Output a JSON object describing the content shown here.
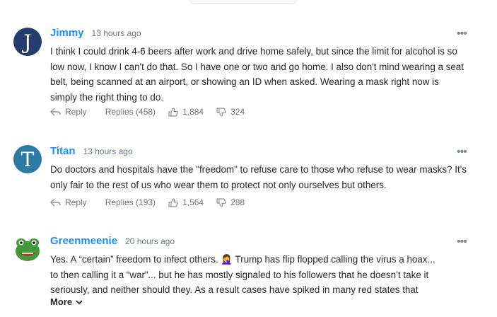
{
  "comments": [
    {
      "author": "Jimmy",
      "time": "13 hours ago",
      "avatar_letter": "J",
      "text": "I think I could drink 4-6 beers after work and drive home safely, but since the limit for alcohol is so low now, I know I can't do that. So I have one or two and go home. I also don't mind wearing a seat belt, being scanned at an airport, or showing an ID when asked. Wearing a mask right now is simply the right thing to do.",
      "reply_label": "Reply",
      "replies_label": "Replies (458)",
      "likes": "1,884",
      "dislikes": "324"
    },
    {
      "author": "Titan",
      "time": "13 hours ago",
      "avatar_letter": "T",
      "text": "Do doctors and hospitals have the \"freedom\" to refuse care to those who refuse to wear masks? It's only fair to the rest of us who wear them to protect not only ourselves but others.",
      "reply_label": "Reply",
      "replies_label": "Replies (193)",
      "likes": "1,564",
      "dislikes": "288"
    },
    {
      "author": "Greenmeenie",
      "time": "20 hours ago",
      "text_line1": "Yes. A “certain” freedom to infect others. 🤦‍♀️ Trump has flip flopped calling the virus a hoax...",
      "text_rest": "to then calling it a “war”... but he has mostly signaled to his followers that he doesn’t take it seriously, and neither should they. As a result cases have spiked in many red states that",
      "more_label": "More"
    }
  ],
  "icons": {
    "reply": "reply-arrow-icon",
    "like": "thumbs-up-icon",
    "dislike": "thumbs-down-icon",
    "options": "more-options-icon",
    "expand": "chevron-down-icon"
  },
  "colors": {
    "author": "#188fff",
    "meta": "#6e7780",
    "text": "#26282a"
  }
}
